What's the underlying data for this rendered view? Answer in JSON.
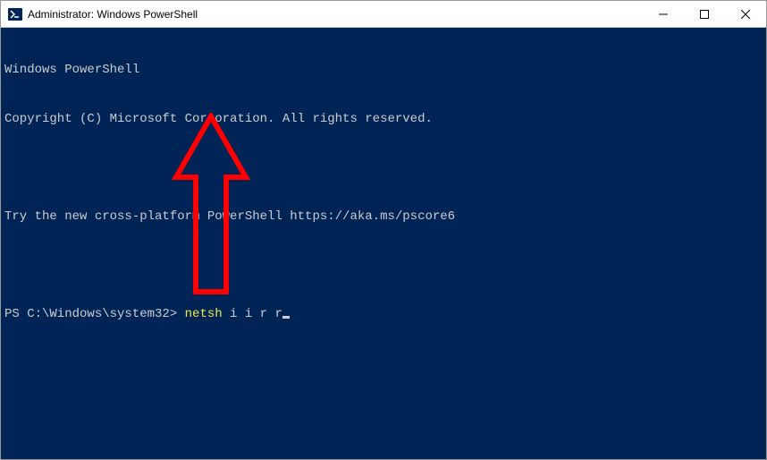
{
  "window": {
    "title": "Administrator: Windows PowerShell"
  },
  "terminal": {
    "line1": "Windows PowerShell",
    "line2": "Copyright (C) Microsoft Corporation. All rights reserved.",
    "blank1": " ",
    "line3": "Try the new cross-platform PowerShell https://aka.ms/pscore6",
    "blank2": " ",
    "prompt": "PS C:\\Windows\\system32> ",
    "command_keyword": "netsh",
    "command_args": " i i r r"
  },
  "colors": {
    "terminal_bg": "#012456",
    "terminal_fg": "#cccccc",
    "command_highlight": "#f1e94b",
    "annotation": "#ff0000"
  }
}
